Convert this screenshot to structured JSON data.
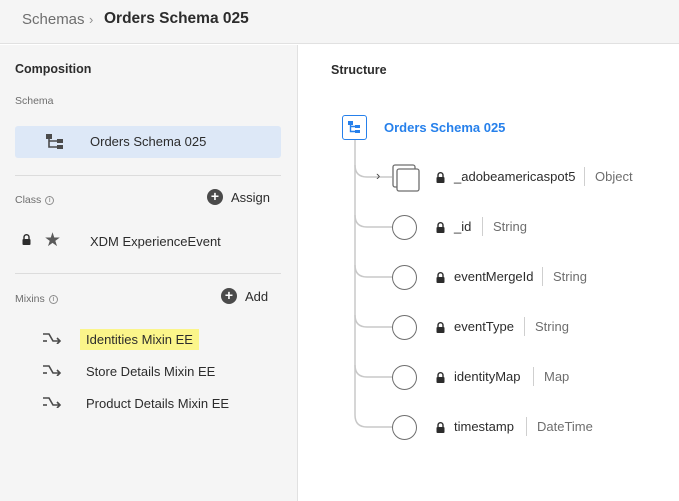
{
  "breadcrumb": {
    "parent": "Schemas",
    "separator": "›",
    "current": "Orders Schema 025"
  },
  "composition": {
    "title": "Composition",
    "schema_label": "Schema",
    "schema_name": "Orders Schema 025",
    "class_label": "Class",
    "assign_label": "Assign",
    "class_name": "XDM ExperienceEvent",
    "mixins_label": "Mixins",
    "add_label": "Add",
    "mixins": [
      {
        "name": "Identities Mixin EE",
        "highlighted": true
      },
      {
        "name": "Store Details Mixin EE",
        "highlighted": false
      },
      {
        "name": "Product Details Mixin EE",
        "highlighted": false
      }
    ]
  },
  "structure": {
    "title": "Structure",
    "root": "Orders Schema 025",
    "fields": [
      {
        "name": "_adobeamericaspot5",
        "type": "Object",
        "expandable": true
      },
      {
        "name": "_id",
        "type": "String",
        "expandable": false
      },
      {
        "name": "eventMergeId",
        "type": "String",
        "expandable": false
      },
      {
        "name": "eventType",
        "type": "String",
        "expandable": false
      },
      {
        "name": "identityMap",
        "type": "Map",
        "expandable": false
      },
      {
        "name": "timestamp",
        "type": "DateTime",
        "expandable": false
      }
    ]
  },
  "colors": {
    "accent": "#2680eb",
    "selected_bg": "#dde8f7",
    "highlight": "#fbf58a",
    "panel_bg": "#f5f5f5"
  },
  "icons": {
    "schema": "schema-tree-icon",
    "lock": "lock-icon",
    "class": "star-icon",
    "mixin": "mixin-arrow-icon",
    "add": "plus-circle-icon",
    "info": "info-icon",
    "expand": "chevron-right-icon",
    "object": "object-stack-icon",
    "field": "field-circle-icon"
  }
}
